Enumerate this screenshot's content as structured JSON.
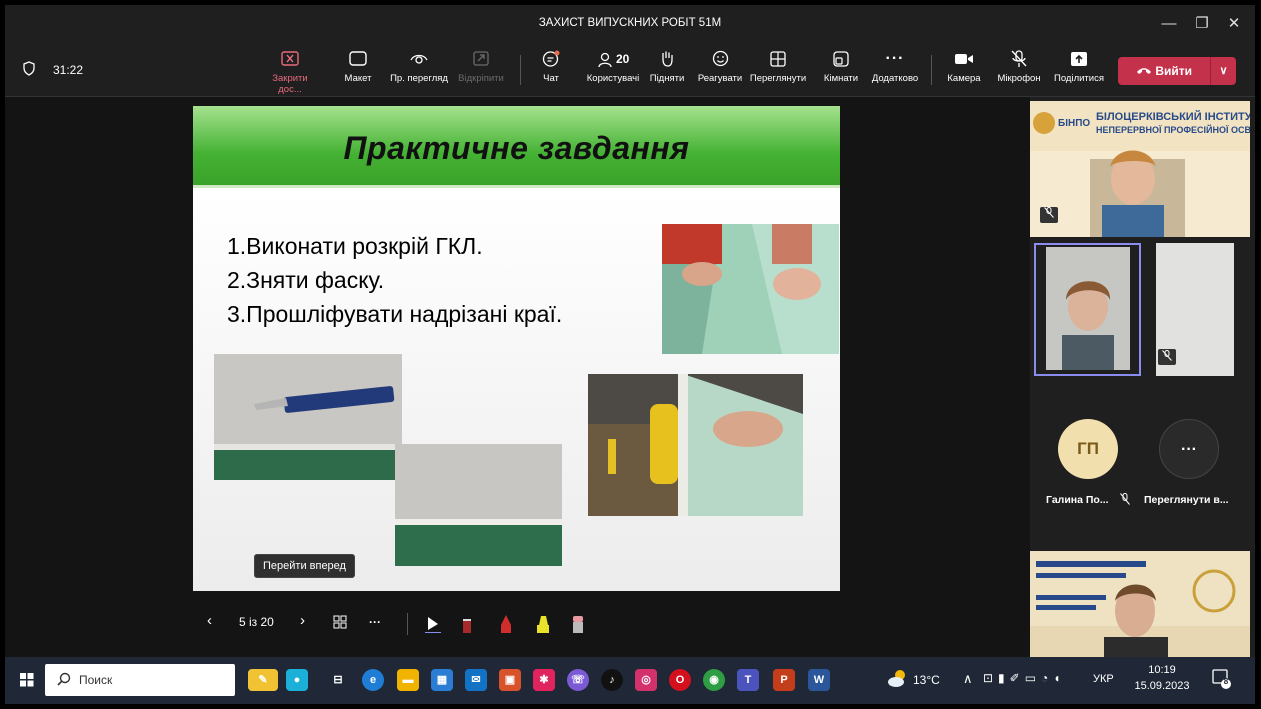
{
  "window": {
    "title": "ЗАХИСТ ВИПУСКНИХ РОБІТ 51М"
  },
  "meeting": {
    "timer": "31:22"
  },
  "toolbar": {
    "stop_share": "Закрити дос...",
    "layout": "Макет",
    "presenter_view": "Пр. перегляд",
    "unpin": "Відкріпити",
    "chat": "Чат",
    "people": "Користувачі",
    "people_count": "20",
    "raise": "Підняти",
    "react": "Реагувати",
    "view": "Переглянути",
    "rooms": "Кімнати",
    "more": "Додатково",
    "camera": "Камера",
    "mic": "Мікрофон",
    "share": "Поділитися",
    "leave": "Вийти"
  },
  "slide": {
    "title": "Практичне завдання",
    "tasks": [
      "1.Виконати розкрій ГКЛ.",
      "2.Зняти фаску.",
      "3.Прошліфувати надрізані краї."
    ]
  },
  "slide_nav": {
    "counter": "5 із 20",
    "tooltip": "Перейти вперед"
  },
  "participants": {
    "banner_line1": "БІЛОЦЕРКІВСЬКИЙ ІНСТИТУТ",
    "banner_line2": "НЕПЕРЕРВНОЇ ПРОФЕСІЙНОЇ ОСВІТИ",
    "banner_logo": "БІНПО",
    "avatar_initials": "ГП",
    "avatar_name": "Галина По...",
    "more_label": "Переглянути в...",
    "more_glyph": "···"
  },
  "taskbar": {
    "search": "Поиск",
    "weather": "13°C",
    "lang": "УКР",
    "time": "10:19",
    "date": "15.09.2023",
    "notif": "8"
  },
  "colors": {
    "accent": "#c4314b",
    "slide_green": "#45b234",
    "selection": "#8b8cf0"
  }
}
